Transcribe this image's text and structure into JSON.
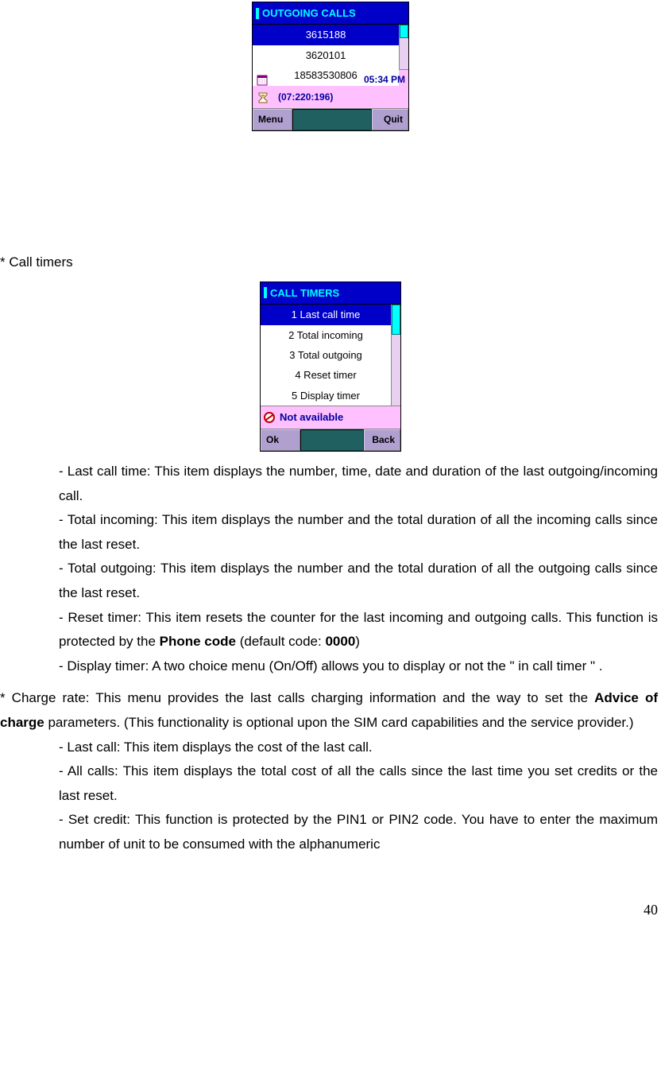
{
  "phone1": {
    "title": "OUTGOING CALLS",
    "entries": [
      "3615188",
      "3620101",
      "18583530806"
    ],
    "status_time": "05:34 PM",
    "status_duration": "(07:220:196)",
    "softkey_left": "Menu",
    "softkey_right": "Quit"
  },
  "label_call_timers": "* Call timers",
  "phone2": {
    "title": "CALL TIMERS",
    "items": [
      "1 Last call time",
      "2 Total incoming",
      "3 Total outgoing",
      "4 Reset timer",
      "5 Display timer"
    ],
    "status_text": "Not available",
    "softkey_left": "Ok",
    "softkey_right": "Back"
  },
  "bullets1": {
    "b1": "- Last call time: This item displays the number, time, date and duration of the last outgoing/incoming call.",
    "b2": "- Total incoming: This item displays the number and the total duration of all the incoming calls since the last reset.",
    "b3": "- Total outgoing: This item displays the number and the total duration of all the outgoing calls since the last reset.",
    "b4_pre": "- Reset timer: This item resets the counter for the last incoming and outgoing calls. This function is protected by the ",
    "b4_bold1": "Phone code",
    "b4_mid": " (default code: ",
    "b4_bold2": "0000",
    "b4_post": ")",
    "b5": "- Display timer: A two choice menu (On/Off) allows you to display or not the \" in call timer \" ."
  },
  "charge_pre": "* Charge rate: This menu provides the last calls charging information and the way to set the ",
  "charge_bold": "Advice of charge",
  "charge_post": " parameters. (This functionality is optional upon the SIM card capabilities and the service provider.)",
  "bullets2": {
    "b1": "- Last call: This item displays the cost of the last call.",
    "b2": "- All calls: This item displays the total cost of all the calls since the last time you set credits or the last reset.",
    "b3": "- Set credit: This function is protected by the PIN1 or PIN2 code. You have to enter the maximum number of unit to be consumed with the alphanumeric"
  },
  "page_number": "40"
}
